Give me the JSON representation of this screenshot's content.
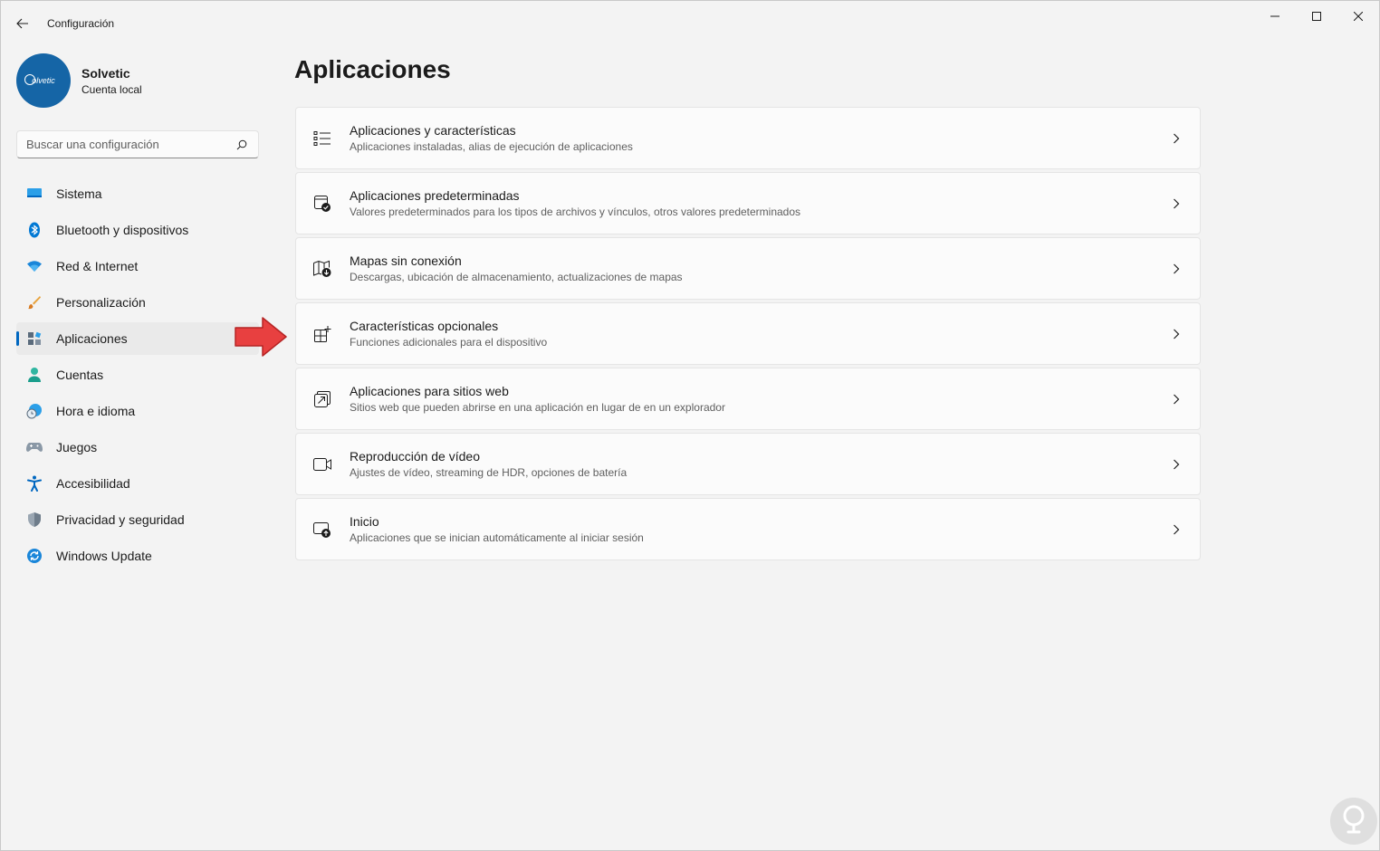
{
  "window": {
    "title": "Configuración"
  },
  "profile": {
    "name": "Solvetic",
    "account_type": "Cuenta local",
    "avatar_text": "olvetic"
  },
  "search": {
    "placeholder": "Buscar una configuración"
  },
  "sidebar": {
    "items": [
      {
        "label": "Sistema",
        "icon": "monitor-icon",
        "active": false
      },
      {
        "label": "Bluetooth y dispositivos",
        "icon": "bluetooth-icon",
        "active": false
      },
      {
        "label": "Red & Internet",
        "icon": "wifi-icon",
        "active": false
      },
      {
        "label": "Personalización",
        "icon": "brush-icon",
        "active": false
      },
      {
        "label": "Aplicaciones",
        "icon": "apps-icon",
        "active": true
      },
      {
        "label": "Cuentas",
        "icon": "person-icon",
        "active": false
      },
      {
        "label": "Hora e idioma",
        "icon": "clock-globe-icon",
        "active": false
      },
      {
        "label": "Juegos",
        "icon": "gamepad-icon",
        "active": false
      },
      {
        "label": "Accesibilidad",
        "icon": "accessibility-icon",
        "active": false
      },
      {
        "label": "Privacidad y seguridad",
        "icon": "shield-icon",
        "active": false
      },
      {
        "label": "Windows Update",
        "icon": "update-icon",
        "active": false
      }
    ]
  },
  "main": {
    "title": "Aplicaciones",
    "cards": [
      {
        "title": "Aplicaciones y características",
        "description": "Aplicaciones instaladas, alias de ejecución de aplicaciones",
        "icon": "list-icon"
      },
      {
        "title": "Aplicaciones predeterminadas",
        "description": "Valores predeterminados para los tipos de archivos y vínculos, otros valores predeterminados",
        "icon": "default-apps-icon"
      },
      {
        "title": "Mapas sin conexión",
        "description": "Descargas, ubicación de almacenamiento, actualizaciones de mapas",
        "icon": "map-download-icon"
      },
      {
        "title": "Características opcionales",
        "description": "Funciones adicionales para el dispositivo",
        "icon": "grid-add-icon"
      },
      {
        "title": "Aplicaciones para sitios web",
        "description": "Sitios web que pueden abrirse en una aplicación en lugar de en un explorador",
        "icon": "open-in-app-icon"
      },
      {
        "title": "Reproducción de vídeo",
        "description": "Ajustes de vídeo, streaming de HDR, opciones de batería",
        "icon": "video-icon"
      },
      {
        "title": "Inicio",
        "description": "Aplicaciones que se inician automáticamente al iniciar sesión",
        "icon": "startup-icon"
      }
    ]
  },
  "colors": {
    "accent": "#0067c0",
    "annotation_arrow": "#e84040",
    "avatar_bg": "#1565a6"
  }
}
